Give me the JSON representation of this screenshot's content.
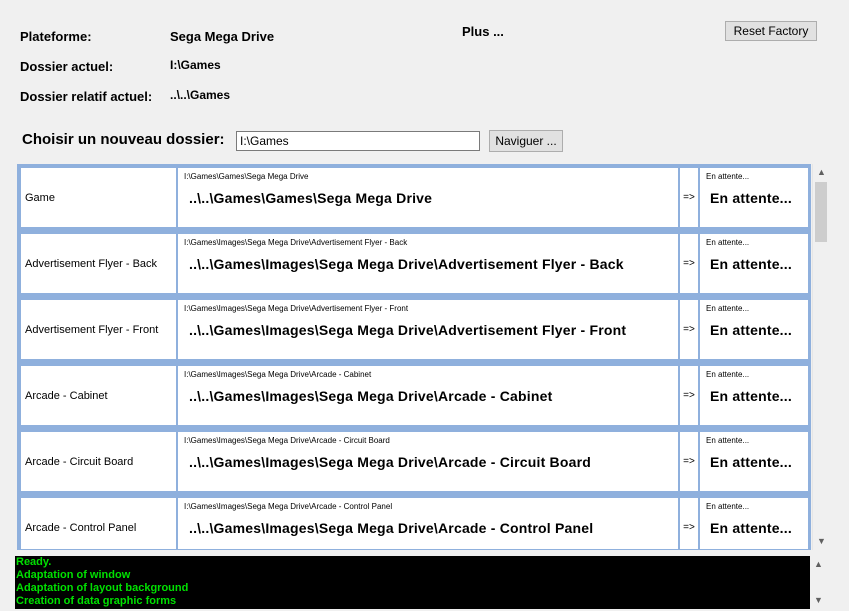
{
  "info": {
    "platform_label": "Plateforme:",
    "platform_value": "Sega Mega Drive",
    "current_folder_label": "Dossier actuel:",
    "current_folder_value": "I:\\Games",
    "relative_folder_label": "Dossier relatif actuel:",
    "relative_folder_value": "..\\..\\Games"
  },
  "plus_label": "Plus ...",
  "reset_label": "Reset Factory",
  "choose": {
    "label": "Choisir un nouveau dossier:",
    "value": "I:\\Games",
    "browse_label": "Naviguer ..."
  },
  "rows": [
    {
      "name": "Game",
      "path_small": "I:\\Games\\Games\\Sega Mega Drive",
      "path_big": "..\\..\\Games\\Games\\Sega Mega Drive",
      "arrow": "=>",
      "status_small": "En attente...",
      "status_big": "En attente..."
    },
    {
      "name": "Advertisement Flyer - Back",
      "path_small": "I:\\Games\\Images\\Sega Mega Drive\\Advertisement Flyer - Back",
      "path_big": "..\\..\\Games\\Images\\Sega Mega Drive\\Advertisement Flyer - Back",
      "arrow": "=>",
      "status_small": "En attente...",
      "status_big": "En attente..."
    },
    {
      "name": "Advertisement Flyer - Front",
      "path_small": "I:\\Games\\Images\\Sega Mega Drive\\Advertisement Flyer - Front",
      "path_big": "..\\..\\Games\\Images\\Sega Mega Drive\\Advertisement Flyer - Front",
      "arrow": "=>",
      "status_small": "En attente...",
      "status_big": "En attente..."
    },
    {
      "name": "Arcade - Cabinet",
      "path_small": "I:\\Games\\Images\\Sega Mega Drive\\Arcade - Cabinet",
      "path_big": "..\\..\\Games\\Images\\Sega Mega Drive\\Arcade - Cabinet",
      "arrow": "=>",
      "status_small": "En attente...",
      "status_big": "En attente..."
    },
    {
      "name": "Arcade - Circuit Board",
      "path_small": "I:\\Games\\Images\\Sega Mega Drive\\Arcade - Circuit Board",
      "path_big": "..\\..\\Games\\Images\\Sega Mega Drive\\Arcade - Circuit Board",
      "arrow": "=>",
      "status_small": "En attente...",
      "status_big": "En attente..."
    },
    {
      "name": "Arcade - Control Panel",
      "path_small": "I:\\Games\\Images\\Sega Mega Drive\\Arcade - Control Panel",
      "path_big": "..\\..\\Games\\Images\\Sega Mega Drive\\Arcade - Control Panel",
      "arrow": "=>",
      "status_small": "En attente...",
      "status_big": "En attente..."
    }
  ],
  "console_lines": [
    "Ready.",
    "Adaptation of window",
    "Adaptation of layout background",
    "Creation of data graphic forms"
  ],
  "colors": {
    "grid_border": "#8fb0dd",
    "console_bg": "#000000",
    "console_text": "#00e000"
  },
  "icons": {
    "scroll_up": "chevron-up-icon",
    "scroll_down": "chevron-down-icon"
  }
}
